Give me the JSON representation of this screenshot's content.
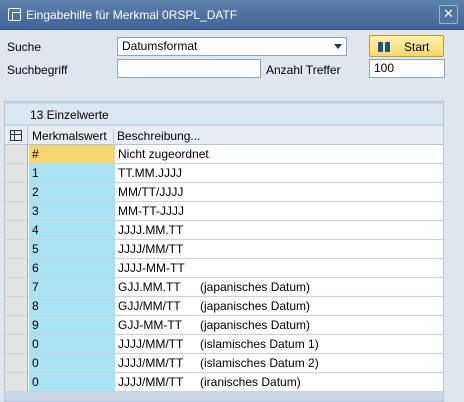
{
  "window": {
    "title": "Eingabehilfe für Merkmal 0RSPL_DATF",
    "close_glyph": "✕"
  },
  "search": {
    "suche_label": "Suche",
    "suche_value": "Datumsformat",
    "suchbegriff_label": "Suchbegriff",
    "suchbegriff_value": "",
    "anzahl_label": "Anzahl Treffer",
    "anzahl_value": "100",
    "start_label": "Start"
  },
  "list": {
    "count_text": "13  Einzelwerte",
    "col_merkmalswert": "Merkmalswert",
    "col_beschreibung": "Beschreibung...",
    "rows": [
      {
        "value": "#",
        "format": "Nicht zugeordnet",
        "note": ""
      },
      {
        "value": "1",
        "format": "TT.MM.JJJJ",
        "note": ""
      },
      {
        "value": "2",
        "format": "MM/TT/JJJJ",
        "note": ""
      },
      {
        "value": "3",
        "format": "MM-TT-JJJJ",
        "note": ""
      },
      {
        "value": "4",
        "format": "JJJJ.MM.TT",
        "note": ""
      },
      {
        "value": "5",
        "format": "JJJJ/MM/TT",
        "note": ""
      },
      {
        "value": "6",
        "format": "JJJJ-MM-TT",
        "note": ""
      },
      {
        "value": "7",
        "format": "GJJ.MM.TT",
        "note": "(japanisches Datum)"
      },
      {
        "value": "8",
        "format": "GJJ/MM/TT",
        "note": "(japanisches Datum)"
      },
      {
        "value": "9",
        "format": "GJJ-MM-TT",
        "note": "(japanisches Datum)"
      },
      {
        "value": "0",
        "format": "JJJJ/MM/TT",
        "note": "(islamisches Datum 1)"
      },
      {
        "value": "0",
        "format": "JJJJ/MM/TT",
        "note": "(islamisches Datum 2)"
      },
      {
        "value": "0",
        "format": "JJJJ/MM/TT",
        "note": "(iranisches Datum)"
      }
    ]
  },
  "colors": {
    "titlebar": "#4a70a0",
    "key_column": "#a9e2f0",
    "selected_key": "#f9d572",
    "start_button": "#f6d86a"
  },
  "icons": {
    "title": "window-icon",
    "start": "binoculars-icon",
    "grid_settings": "grid-settings-icon"
  }
}
